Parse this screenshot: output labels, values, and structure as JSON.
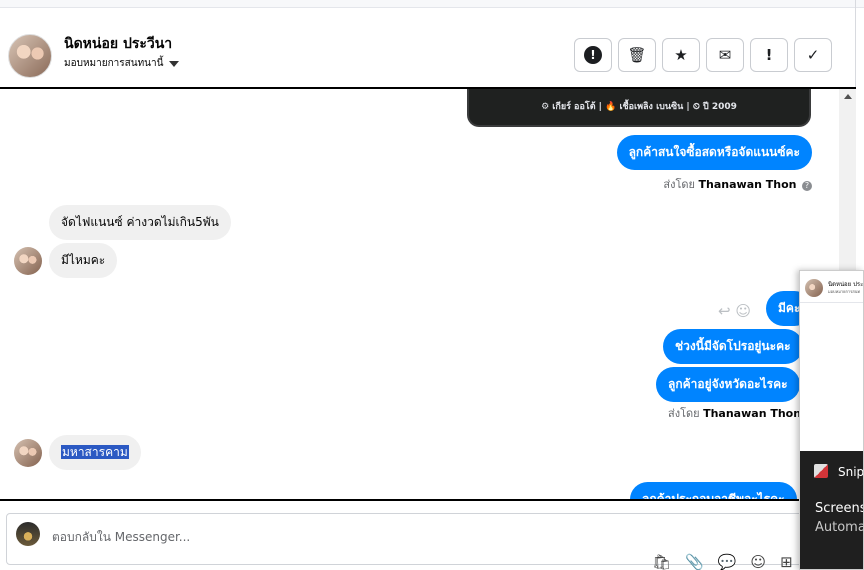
{
  "header": {
    "name": "นิดหน่อย ประวีนา",
    "subtitle": "มอบหมายการสนทนานี้",
    "actions": [
      {
        "icon": "alert-circle-icon",
        "glyph": "!"
      },
      {
        "icon": "trash-icon",
        "glyph": "🗑"
      },
      {
        "icon": "star-icon",
        "glyph": "★"
      },
      {
        "icon": "envelope-icon",
        "glyph": "✉"
      },
      {
        "icon": "exclamation-icon",
        "glyph": "!"
      },
      {
        "icon": "check-icon",
        "glyph": "✓"
      }
    ]
  },
  "card": {
    "specs": "⚙ เกียร์ ออโต้   |   🔥 เชื้อเพลิง เบนซิน   |   ⏲ ปี 2009"
  },
  "messages": {
    "out1": "ลูกค้าสนใจซื้อสดหรือจัดแนนซ์คะ",
    "sent_prefix": "ส่งโดย",
    "sent_name": "Thanawan Thon",
    "in1": "จัดไฟแนนซ์ ค่างวดไม่เกิน5พัน",
    "in2": "มีไหมคะ",
    "out2": "มีคะ",
    "out3": "ช่วงนี้มีจัดโปรอยู่นะคะ",
    "out4": "ลูกค้าอยู่จังหวัดอะไรคะ",
    "in3": "มหาสารคาม",
    "out5": "ลูกค้าประกอบอาชีพอะไรคะ"
  },
  "composer": {
    "placeholder": "ตอบกลับใน Messenger..."
  },
  "popup": {
    "name": "นิดหน่อย ประ",
    "sub": "มอบหมายการสนท",
    "snip_title": "Snip",
    "snip_line1": "Screensh",
    "snip_line2": "Automa"
  }
}
